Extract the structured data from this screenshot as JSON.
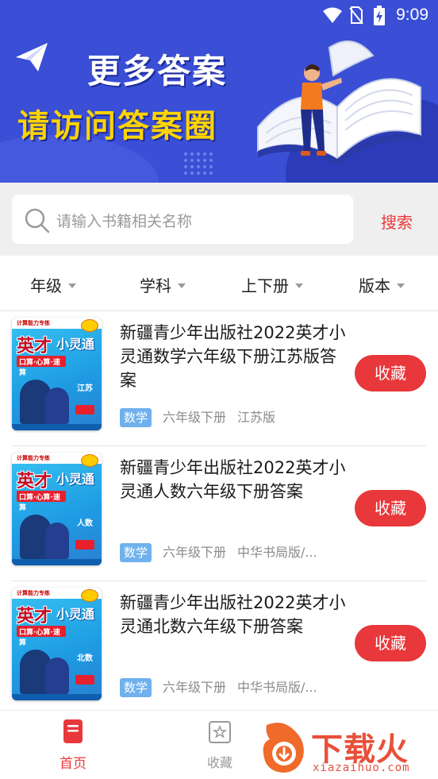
{
  "status_bar": {
    "time": "9:09"
  },
  "banner": {
    "headline": "更多答案",
    "subheadline": "请访问答案圈"
  },
  "search": {
    "placeholder": "请输入书籍相关名称",
    "button_label": "搜索"
  },
  "filters": [
    {
      "label": "年级"
    },
    {
      "label": "学科"
    },
    {
      "label": "上下册"
    },
    {
      "label": "版本"
    }
  ],
  "cover": {
    "series_small": "计算能力专练",
    "brand_big": "英才",
    "brand_small": "小灵通",
    "band_text": "口算·心算·速算"
  },
  "books": [
    {
      "title": "新疆青少年出版社2022英才小灵通数学六年级下册江苏版答案",
      "subject": "数学",
      "grade": "六年级下册",
      "edition": "江苏版",
      "cover_subject": "江苏",
      "fav_label": "收藏"
    },
    {
      "title": "新疆青少年出版社2022英才小灵通人数六年级下册答案",
      "subject": "数学",
      "grade": "六年级下册",
      "edition": "中华书局版/...",
      "cover_subject": "人数",
      "fav_label": "收藏"
    },
    {
      "title": "新疆青少年出版社2022英才小灵通北数六年级下册答案",
      "subject": "数学",
      "grade": "六年级下册",
      "edition": "中华书局版/...",
      "cover_subject": "北数",
      "fav_label": "收藏"
    }
  ],
  "bottom_nav": {
    "home_label": "首页",
    "favorites_label": "收藏"
  },
  "watermark": {
    "text": "下载火",
    "url": "xiazaihuo.com"
  },
  "colors": {
    "banner_blue": "#3a4fd6",
    "accent_red": "#e8383b",
    "headline_yellow": "#ffd400",
    "tag_blue": "#6fb1ec"
  }
}
